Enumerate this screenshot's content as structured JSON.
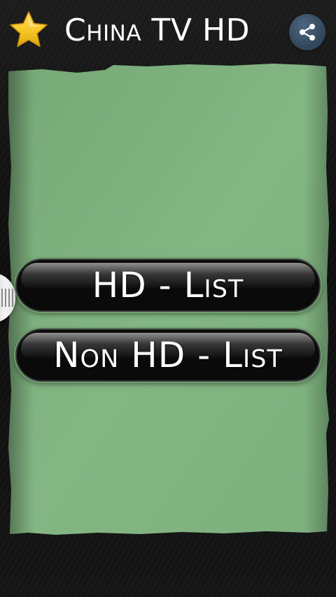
{
  "header": {
    "title": "China TV HD",
    "favorite_icon": "star-icon",
    "share_icon": "share-icon"
  },
  "menu": {
    "hd_list_label": "HD - List",
    "non_hd_list_label": "Non HD - List"
  },
  "drawer": {
    "handle_icon": "drawer-grip-icon"
  },
  "colors": {
    "panel_green": "#82b482",
    "button_black": "#0a0a0a",
    "share_bg": "#34495e",
    "star_yellow": "#f6c624",
    "background": "#111111"
  }
}
